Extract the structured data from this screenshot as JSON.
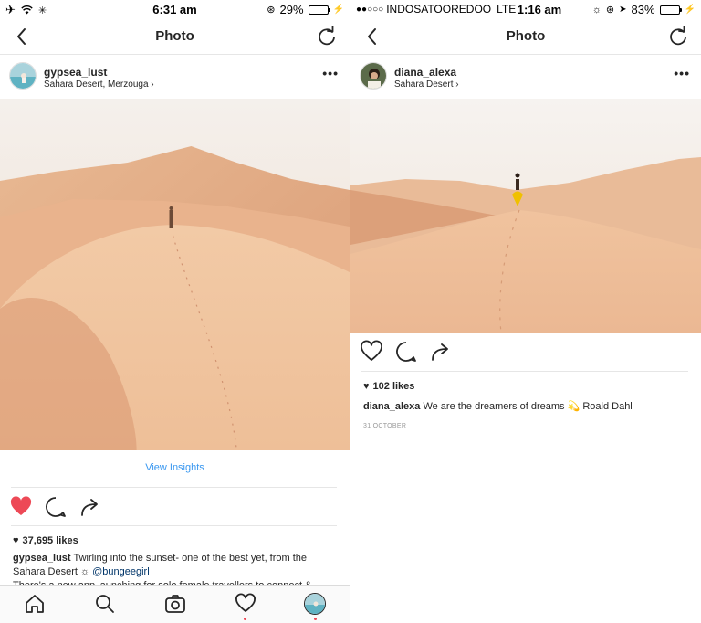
{
  "left": {
    "status": {
      "time": "6:31 am",
      "battery": "29%",
      "battery_level": 0.29
    },
    "nav": {
      "title": "Photo"
    },
    "post": {
      "username": "gypsea_lust",
      "location": "Sahara Desert, Merzouga",
      "view_insights": "View Insights",
      "liked": true,
      "likes": "37,695 likes",
      "caption_username": "gypsea_lust",
      "caption_line1": "Twirling into the sunset- one of the best yet, from the",
      "caption_line2_prefix": "Sahara Desert ☼ ",
      "caption_mention": "@bungeegirl",
      "caption_line3": "There's a new app launching for solo female travellers to connect &"
    },
    "tabs": [
      "home-tab",
      "search-tab",
      "camera-tab",
      "activity-tab",
      "profile-tab"
    ]
  },
  "right": {
    "status": {
      "carrier": "INDOSATOOREDOO",
      "network": "LTE",
      "time": "1:16 am",
      "battery": "83%",
      "battery_level": 0.83
    },
    "nav": {
      "title": "Photo"
    },
    "post": {
      "username": "diana_alexa",
      "location": "Sahara Desert",
      "likes": "102 likes",
      "caption_username": "diana_alexa",
      "caption_text": "We are the dreamers of dreams 💫 Roald Dahl",
      "date": "31 OCTOBER"
    }
  },
  "colors": {
    "like_red": "#ed4956",
    "link_blue": "#3897f0",
    "sand": "#e8b48e",
    "battery_green": "#4cd964"
  }
}
